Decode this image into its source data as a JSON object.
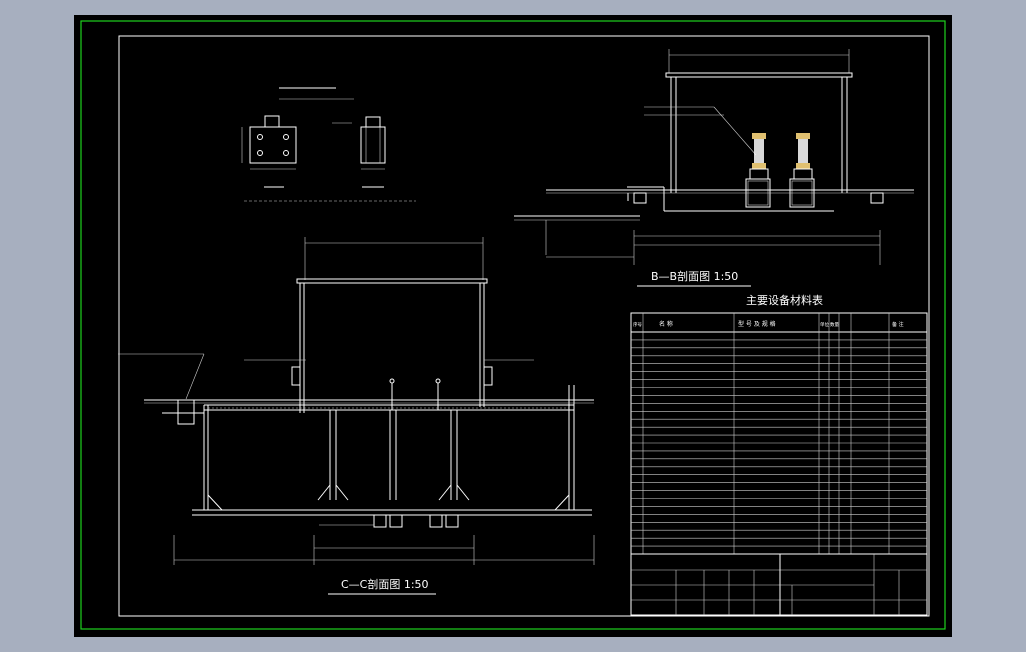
{
  "sections": {
    "bb": {
      "title": "B—B剖面图 1:50"
    },
    "cc": {
      "title": "C—C剖面图 1:50"
    }
  },
  "material_table": {
    "title": "主要设备材料表",
    "headers": [
      "序号",
      "名 称",
      "型 号 及 规 格",
      "单位",
      "数量",
      "备 注"
    ],
    "row_count": 28
  },
  "colors": {
    "background": "#a7afbf",
    "canvas": "#000000",
    "frame": "#1fd11f",
    "lines": "#ffffff",
    "accent": "#e0c070"
  }
}
